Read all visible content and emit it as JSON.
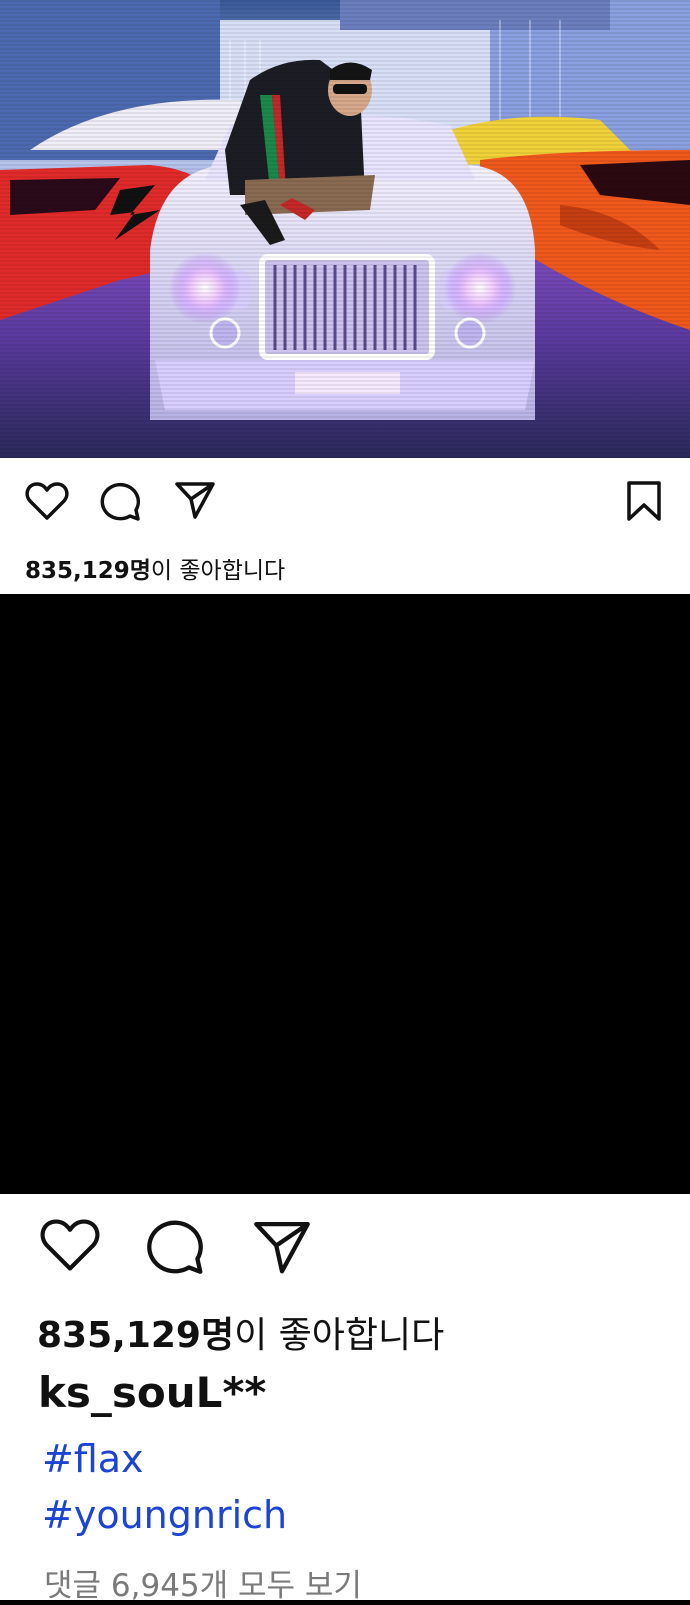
{
  "post_small": {
    "likes_count": "835,129명",
    "likes_suffix": "이 좋아합니다"
  },
  "post_big": {
    "likes_count": "835,129명",
    "likes_suffix": "이 좋아합니다",
    "username": "ks_souL**",
    "hashtags": [
      "#flax",
      "#youngnrich"
    ],
    "comments_link": "댓글 6,945개 모두 보기"
  },
  "colors": {
    "hashtag": "#1b43d6",
    "muted_text": "#7a7a7a",
    "text": "#111111"
  },
  "icons": [
    "heart-icon",
    "comment-icon",
    "share-icon",
    "bookmark-icon"
  ]
}
